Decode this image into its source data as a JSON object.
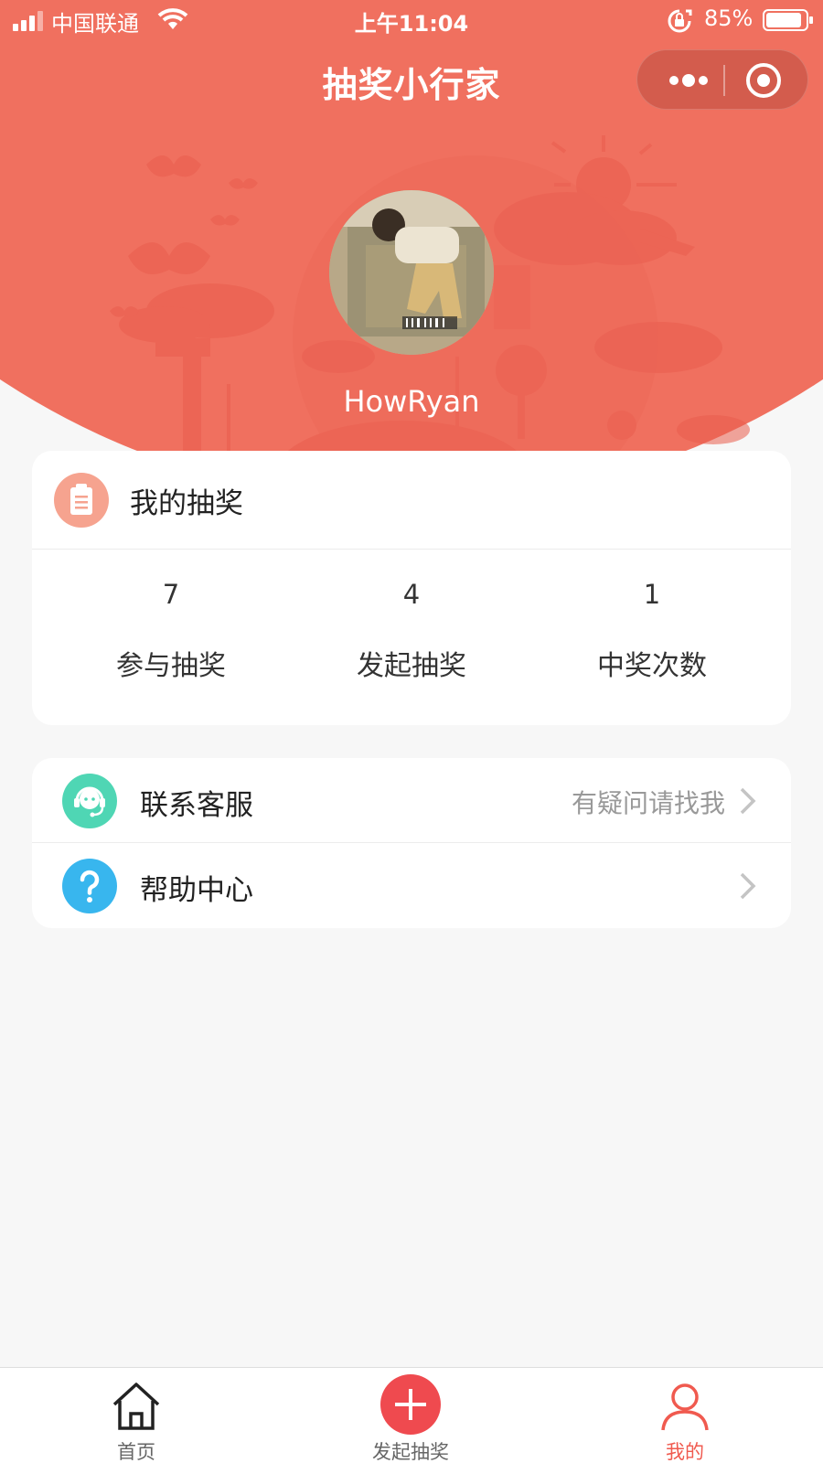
{
  "status_bar": {
    "carrier": "中国联通",
    "time": "上午11:04",
    "battery": "85%"
  },
  "header": {
    "title": "抽奖小行家",
    "accent_color": "#f0705f"
  },
  "profile": {
    "username": "HowRyan"
  },
  "lottery": {
    "title": "我的抽奖",
    "stats": [
      {
        "value": "7",
        "label": "参与抽奖"
      },
      {
        "value": "4",
        "label": "发起抽奖"
      },
      {
        "value": "1",
        "label": "中奖次数"
      }
    ]
  },
  "menu": {
    "items": [
      {
        "label": "联系客服",
        "hint": "有疑问请找我",
        "icon": "customer-service-icon",
        "icon_color": "#4fd6b4"
      },
      {
        "label": "帮助中心",
        "hint": "",
        "icon": "help-icon",
        "icon_color": "#38b6ee"
      }
    ]
  },
  "tabbar": {
    "items": [
      {
        "label": "首页",
        "icon": "home-icon",
        "active": false
      },
      {
        "label": "发起抽奖",
        "icon": "plus-icon",
        "active": false
      },
      {
        "label": "我的",
        "icon": "user-icon",
        "active": true
      }
    ],
    "active_color": "#f05a4f"
  }
}
